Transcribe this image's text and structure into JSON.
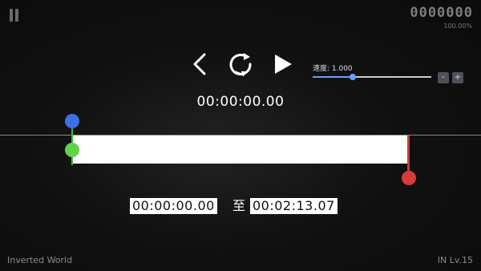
{
  "hud": {
    "score": "0000000",
    "accuracy": "100.00%"
  },
  "controls": {
    "back_icon": "chevron-left-icon",
    "restart_icon": "restart-icon",
    "play_icon": "play-icon"
  },
  "speed": {
    "label": "速度: 1.000",
    "value": 1.0,
    "minus_label": "-",
    "plus_label": "+"
  },
  "current_time": "00:00:00.00",
  "range": {
    "start": "00:00:00.00",
    "separator": "至",
    "end": "00:02:13.07"
  },
  "footer": {
    "song_title": "Inverted World",
    "level": "IN Lv.15"
  },
  "colors": {
    "blue_handle": "#3d6fe0",
    "green_handle": "#5fd34a",
    "red_handle": "#d63c3c",
    "judge_line": "#8d8b63"
  }
}
